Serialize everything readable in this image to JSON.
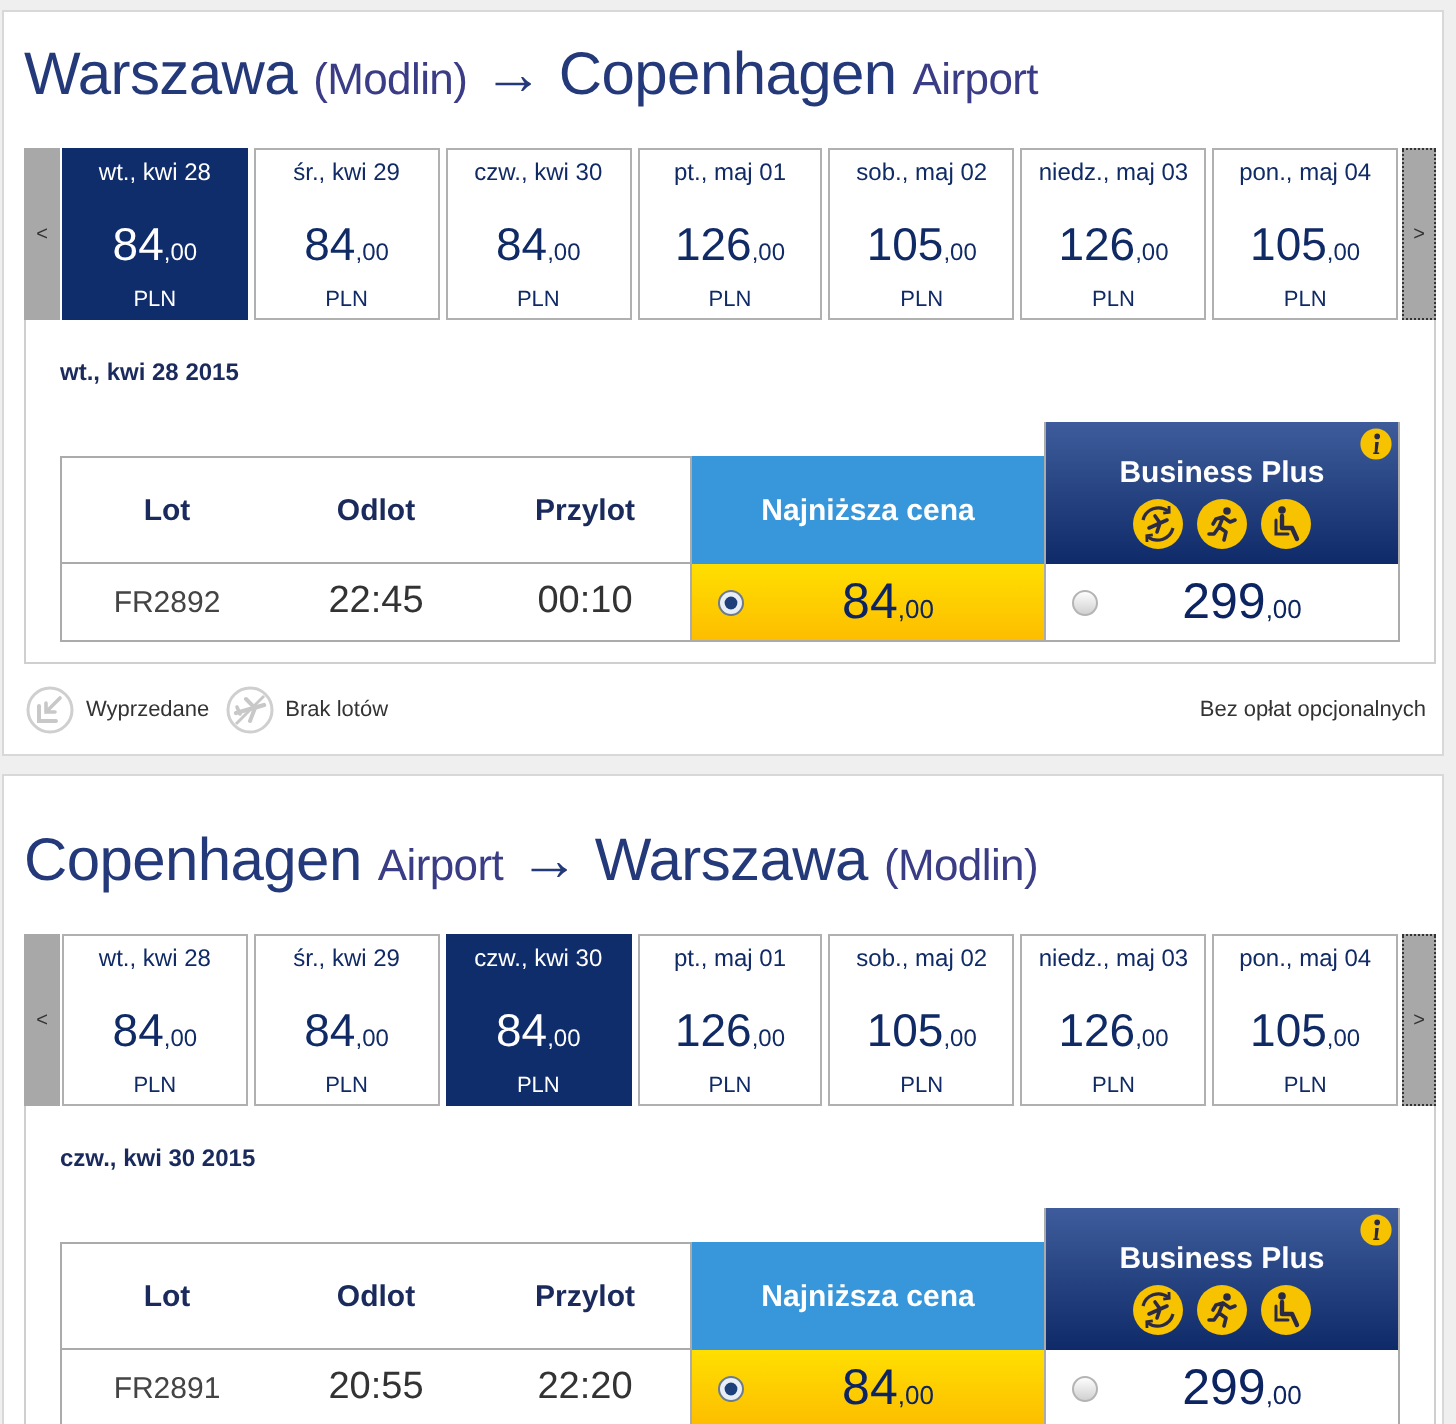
{
  "routes": [
    {
      "title": {
        "origin": "Warszawa",
        "origin_airport": "(Modlin)",
        "arrow": "→",
        "destination": "Copenhagen",
        "destination_airport": "Airport"
      },
      "nav": {
        "previous": "<",
        "next": ">"
      },
      "dates": [
        {
          "label": "wt., kwi 28",
          "price": "84",
          "decimals": ",00",
          "currency": "PLN",
          "selected": true
        },
        {
          "label": "śr., kwi 29",
          "price": "84",
          "decimals": ",00",
          "currency": "PLN",
          "selected": false
        },
        {
          "label": "czw., kwi 30",
          "price": "84",
          "decimals": ",00",
          "currency": "PLN",
          "selected": false
        },
        {
          "label": "pt., maj 01",
          "price": "126",
          "decimals": ",00",
          "currency": "PLN",
          "selected": false
        },
        {
          "label": "sob., maj 02",
          "price": "105",
          "decimals": ",00",
          "currency": "PLN",
          "selected": false
        },
        {
          "label": "niedz., maj 03",
          "price": "126",
          "decimals": ",00",
          "currency": "PLN",
          "selected": false
        },
        {
          "label": "pon., maj 04",
          "price": "105",
          "decimals": ",00",
          "currency": "PLN",
          "selected": false
        }
      ],
      "selected_date": "wt., kwi 28 2015",
      "table": {
        "columns": [
          "Lot",
          "Odlot",
          "Przylot"
        ],
        "fares": [
          {
            "kind": "standard",
            "name": "Najniższa cena"
          },
          {
            "kind": "business",
            "name": "Business Plus"
          }
        ],
        "rows": [
          {
            "flight": "FR2892",
            "departure": "22:45",
            "arrival": "00:10",
            "prices": [
              {
                "price": "84",
                "decimals": ",00",
                "selected": true
              },
              {
                "price": "299",
                "decimals": ",00",
                "selected": false
              }
            ]
          }
        ]
      },
      "legend": {
        "items": [
          {
            "kind": "sold_out",
            "label": "Wyprzedane"
          },
          {
            "kind": "no_flights",
            "label": "Brak lotów"
          }
        ],
        "note": "Bez opłat opcjonalnych"
      }
    },
    {
      "title": {
        "origin": "Copenhagen",
        "origin_airport": "Airport",
        "arrow": "→",
        "destination": "Warszawa",
        "destination_airport": "(Modlin)"
      },
      "nav": {
        "previous": "<",
        "next": ">"
      },
      "dates": [
        {
          "label": "wt., kwi 28",
          "price": "84",
          "decimals": ",00",
          "currency": "PLN",
          "selected": false
        },
        {
          "label": "śr., kwi 29",
          "price": "84",
          "decimals": ",00",
          "currency": "PLN",
          "selected": false
        },
        {
          "label": "czw., kwi 30",
          "price": "84",
          "decimals": ",00",
          "currency": "PLN",
          "selected": true
        },
        {
          "label": "pt., maj 01",
          "price": "126",
          "decimals": ",00",
          "currency": "PLN",
          "selected": false
        },
        {
          "label": "sob., maj 02",
          "price": "105",
          "decimals": ",00",
          "currency": "PLN",
          "selected": false
        },
        {
          "label": "niedz., maj 03",
          "price": "126",
          "decimals": ",00",
          "currency": "PLN",
          "selected": false
        },
        {
          "label": "pon., maj 04",
          "price": "105",
          "decimals": ",00",
          "currency": "PLN",
          "selected": false
        }
      ],
      "selected_date": "czw., kwi 30 2015",
      "table": {
        "columns": [
          "Lot",
          "Odlot",
          "Przylot"
        ],
        "fares": [
          {
            "kind": "standard",
            "name": "Najniższa cena"
          },
          {
            "kind": "business",
            "name": "Business Plus"
          }
        ],
        "rows": [
          {
            "flight": "FR2891",
            "departure": "20:55",
            "arrival": "22:20",
            "prices": [
              {
                "price": "84",
                "decimals": ",00",
                "selected": true
              },
              {
                "price": "299",
                "decimals": ",00",
                "selected": false
              }
            ]
          }
        ]
      }
    }
  ]
}
